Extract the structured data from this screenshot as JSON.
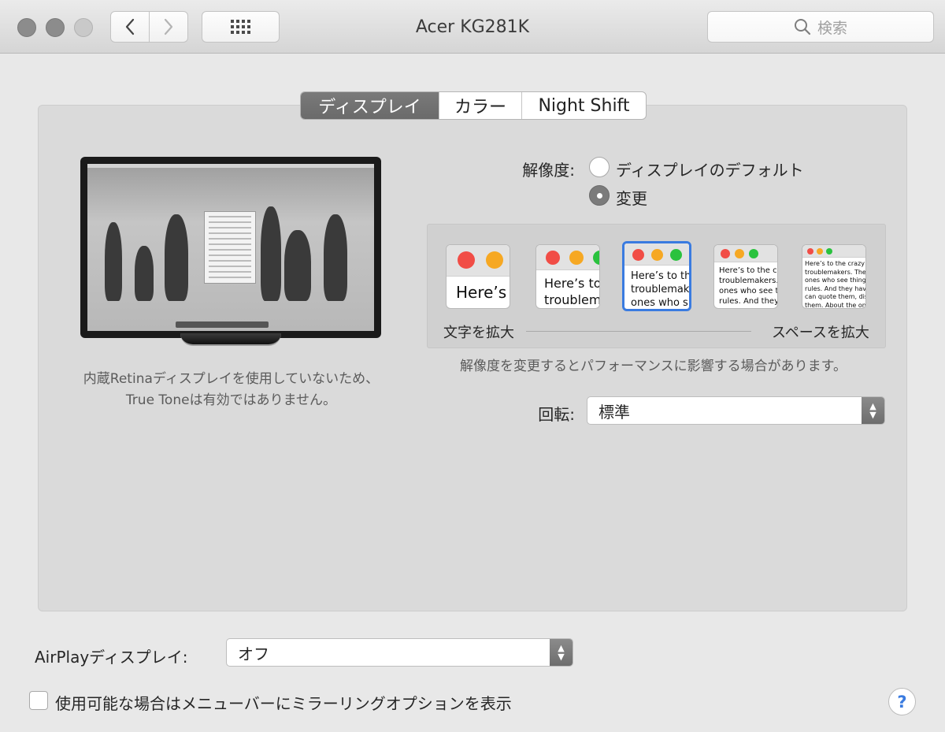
{
  "window": {
    "title": "Acer KG281K"
  },
  "toolbar": {
    "search_placeholder": "検索"
  },
  "tabs": [
    {
      "label": "ディスプレイ",
      "active": true
    },
    {
      "label": "カラー",
      "active": false
    },
    {
      "label": "Night Shift",
      "active": false
    }
  ],
  "retina_note": "内蔵Retinaディスプレイを使用していないため、True Toneは有効ではありません。",
  "resolution": {
    "label": "解像度:",
    "options": [
      {
        "label": "ディスプレイのデフォルト",
        "selected": false
      },
      {
        "label": "変更",
        "selected": true
      }
    ]
  },
  "scaled": {
    "selected_index": 2,
    "thumbnails": [
      {
        "text": "Here’s"
      },
      {
        "text": "Here’s to\ntroublem"
      },
      {
        "text": "Here’s to th\ntroublemak\nones who s"
      },
      {
        "text": "Here’s to the cr\ntroublemakers.\nones who see t\nrules. And they"
      },
      {
        "text": "Here’s to the crazy one\ntroublemakers. The rou\nones who see things dif\nrules. And they have no\ncan quote them, disagr\nthem. About the only th\nBecause they change t"
      }
    ],
    "left_label": "文字を拡大",
    "right_label": "スペースを拡大",
    "note": "解像度を変更するとパフォーマンスに影響する場合があります。"
  },
  "rotation": {
    "label": "回転:",
    "value": "標準"
  },
  "airplay": {
    "label": "AirPlayディスプレイ:",
    "value": "オフ"
  },
  "mirroring": {
    "label": "使用可能な場合はメニューバーにミラーリングオプションを表示",
    "checked": false
  },
  "help": {
    "label": "?"
  },
  "colors": {
    "traffic_gray": "#8c8c8c",
    "selection_blue": "#3a7be0",
    "dot_red": "#f14d46",
    "dot_yellow": "#f6a823",
    "dot_green": "#2ac23e"
  }
}
